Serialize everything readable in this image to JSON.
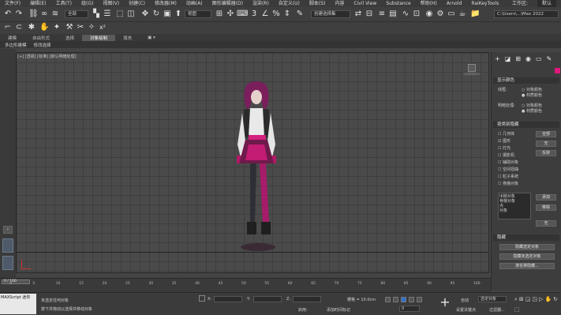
{
  "menubar": {
    "items": [
      "文件(F)",
      "编辑(E)",
      "工具(T)",
      "组(G)",
      "视图(V)",
      "创建(C)",
      "修改器(M)",
      "动画(A)",
      "图形编辑器(D)",
      "渲染(R)",
      "自定义(U)",
      "脚本(S)",
      "内容",
      "Civil View",
      "Substance",
      "帮助(H)",
      "Arnold",
      "RaiKeyTools"
    ],
    "workspace_label": "工作区:",
    "workspace_value": "默认"
  },
  "toolbar": {
    "selection_filter": "全部",
    "named_selection": "创建选择集",
    "path_value": "C:\\Users\\...\\Max 2022"
  },
  "ribbon": {
    "tabs": [
      "建模",
      "自由形式",
      "选择",
      "对象绘制",
      "填充"
    ],
    "active_index": 3
  },
  "ribbon2": {
    "items": [
      "多边形建模",
      "修改选择"
    ]
  },
  "viewport": {
    "label": "[+] [透视] [标准] [默认明暗处理]"
  },
  "command_panel": {
    "tabs_icons": [
      "create-icon",
      "modify-icon",
      "hierarchy-icon",
      "motion-icon",
      "display-icon",
      "utilities-icon"
    ],
    "display_color": {
      "title": "显示颜色",
      "wireframe_label": "线框:",
      "wireframe_options": [
        "对象颜色",
        "材质颜色"
      ],
      "shaded_label": "明暗处理:",
      "shaded_options": [
        "对象颜色",
        "材质颜色"
      ]
    },
    "hide_by_category": {
      "title": "按类别隐藏",
      "items": [
        "几何体",
        "图形",
        "灯光",
        "摄影机",
        "辅助对象",
        "空间扭曲",
        "粒子系统",
        "骨骼对象"
      ],
      "checked": [
        false,
        true,
        false,
        false,
        false,
        false,
        false,
        false
      ],
      "buttons": [
        "全部",
        "无",
        "反转"
      ],
      "list_items": [
        "IK链对象",
        "骨骼对象",
        "点",
        "对象"
      ],
      "side_buttons": [
        "添加",
        "移除",
        "无"
      ]
    },
    "hide": {
      "title": "隐藏",
      "buttons": [
        "隐藏选定对象",
        "隐藏未选定对象",
        "按名称隐藏..."
      ]
    }
  },
  "timeline": {
    "frame_label": "0 / 100",
    "ticks": [
      "0",
      "5",
      "10",
      "15",
      "20",
      "25",
      "30",
      "35",
      "40",
      "45",
      "50",
      "55",
      "60",
      "65",
      "70",
      "75",
      "80",
      "85",
      "90",
      "95",
      "100"
    ]
  },
  "statusbar": {
    "script_label": "MAXScript 迷你",
    "status_line1": "未选定任何对象",
    "status_line2": "按下并拖动以选择并移动对象",
    "x_label": "X:",
    "y_label": "Y:",
    "z_label": "Z:",
    "grid_label": "栅格 = 10.0cm",
    "enabled_label": "启用:",
    "add_time_tag": "添加时间标记",
    "auto_label": "自动",
    "set_key_label": "设置关键点",
    "selection_set": "选定对象",
    "key_filters": "过滤器...",
    "frame_value": "0"
  },
  "colors": {
    "accent_pink": "#e0187a",
    "viewport_bg": "#4a4a4a",
    "panel_bg": "#3d3d3d"
  }
}
